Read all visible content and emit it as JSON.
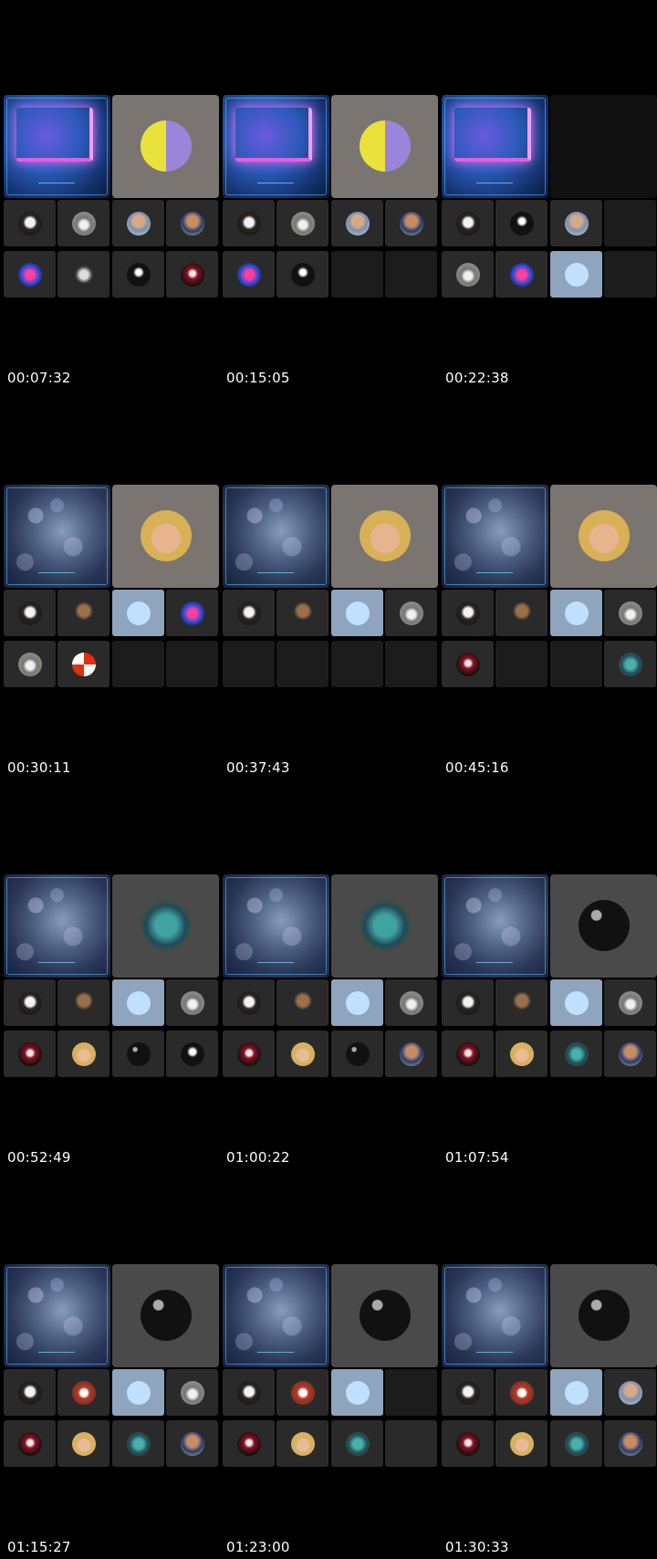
{
  "timestamps": [
    "00:07:32",
    "00:15:05",
    "00:22:38",
    "00:30:11",
    "00:37:43",
    "00:45:16",
    "00:52:49",
    "01:00:22",
    "01:07:54",
    "01:15:27",
    "01:23:00",
    "01:30:33"
  ],
  "frames": [
    {
      "main": "neon",
      "speaker": {
        "bg": "light",
        "avatar": "av-yellow"
      },
      "tiles": [
        "av-night",
        "av-car",
        "av-man",
        "av-man2",
        "av-pink",
        "av-helmet",
        "av-suit",
        "av-red"
      ]
    },
    {
      "main": "neon",
      "speaker": {
        "bg": "light",
        "avatar": "av-yellow"
      },
      "tiles": [
        "av-night",
        "av-car",
        "av-man",
        "av-man2",
        "av-pink",
        "av-suit",
        "",
        ""
      ]
    },
    {
      "main": "neon",
      "speaker": {
        "bg": "dark",
        "avatar": ""
      },
      "tiles": [
        "av-night",
        "av-suit",
        "av-man",
        "",
        "av-car",
        "av-pink",
        "av-sky",
        ""
      ]
    },
    {
      "main": "crowd",
      "speaker": {
        "bg": "light",
        "avatar": "av-blonde"
      },
      "tiles": [
        "av-night",
        "av-profile",
        "av-sky",
        "av-pink",
        "av-car",
        "av-ball",
        "",
        ""
      ]
    },
    {
      "main": "crowd",
      "speaker": {
        "bg": "light",
        "avatar": "av-blonde"
      },
      "tiles": [
        "av-night",
        "av-profile",
        "av-sky",
        "av-car",
        "",
        "",
        "",
        ""
      ]
    },
    {
      "main": "crowd",
      "speaker": {
        "bg": "light",
        "avatar": "av-blonde"
      },
      "tiles": [
        "av-night",
        "av-profile",
        "av-sky",
        "av-car",
        "av-red",
        "",
        "",
        "av-fish-sm"
      ]
    },
    {
      "main": "crowd",
      "speaker": {
        "bg": "mid",
        "avatar": "av-fish"
      },
      "tiles": [
        "av-night",
        "av-profile",
        "av-sky",
        "av-car",
        "av-red",
        "av-blonde-sm",
        "av-mic",
        "av-suit"
      ]
    },
    {
      "main": "crowd",
      "speaker": {
        "bg": "mid",
        "avatar": "av-fish"
      },
      "tiles": [
        "av-night",
        "av-profile",
        "av-sky",
        "av-car",
        "av-red",
        "av-blonde-sm",
        "av-mic",
        "av-man2"
      ]
    },
    {
      "main": "crowd",
      "speaker": {
        "bg": "mid",
        "avatar": "av-mic"
      },
      "tiles": [
        "av-night",
        "av-profile",
        "av-sky",
        "av-car",
        "av-red",
        "av-blonde-sm",
        "av-fish-sm",
        "av-man2"
      ]
    },
    {
      "main": "crowd",
      "speaker": {
        "bg": "mid",
        "avatar": "av-mic"
      },
      "tiles": [
        "av-night",
        "av-smile",
        "av-sky",
        "av-car",
        "av-red",
        "av-blonde-sm",
        "av-fish-sm",
        "av-man2"
      ]
    },
    {
      "main": "crowd",
      "speaker": {
        "bg": "mid",
        "avatar": "av-mic"
      },
      "tiles": [
        "av-night",
        "av-smile",
        "av-sky",
        "",
        "av-red",
        "av-blonde-sm",
        "av-fish-sm",
        "blank-filled"
      ]
    },
    {
      "main": "crowd",
      "speaker": {
        "bg": "mid",
        "avatar": "av-mic"
      },
      "tiles": [
        "av-night",
        "av-smile",
        "av-sky",
        "av-man",
        "av-red",
        "av-blonde-sm",
        "av-fish-sm",
        "av-man2"
      ]
    }
  ]
}
